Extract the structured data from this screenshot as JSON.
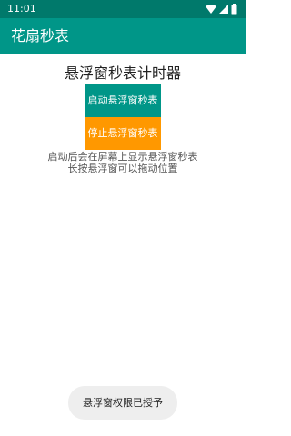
{
  "status_bar": {
    "time": "11:01",
    "icons": [
      "wifi-icon",
      "signal-icon",
      "battery-icon"
    ],
    "color": "#00796b"
  },
  "app_bar": {
    "title": "花扇秒表",
    "color": "#009688"
  },
  "main": {
    "heading": "悬浮窗秒表计时器",
    "start_button_label": "启动悬浮窗秒表",
    "start_button_color": "#009688",
    "stop_button_label": "停止悬浮窗秒表",
    "stop_button_color": "#ff9800",
    "description_line1": "启动后会在屏幕上显示悬浮窗秒表",
    "description_line2": "长按悬浮窗可以拖动位置"
  },
  "toast": {
    "message": "悬浮窗权限已授予"
  }
}
